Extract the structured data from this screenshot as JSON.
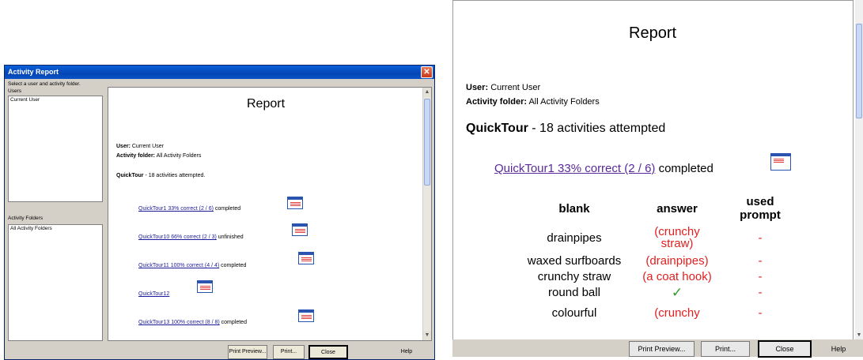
{
  "left_window": {
    "title": "Activity Report",
    "close_glyph": "✕",
    "instructions": "Select a user and activity folder.",
    "users_label": "Users",
    "users": [
      "Current User"
    ],
    "folders_label": "Activity Folders",
    "folders": [
      "All Activity Folders"
    ],
    "report": {
      "title": "Report",
      "user_label": "User:",
      "user_value": "Current User",
      "folder_label": "Activity folder:",
      "folder_value": "All Activity Folders",
      "section_name": "QuickTour",
      "section_summary": " - 18 activities attempted.",
      "entries": [
        {
          "link": "QuickTour1   33% correct (2 / 6)",
          "status": " completed"
        },
        {
          "link": "QuickTour10   66% correct (2 / 3)",
          "status": " unfinished"
        },
        {
          "link": "QuickTour11   100% correct (4 / 4)",
          "status": " completed"
        },
        {
          "link": "QuickTour12   ",
          "status": ""
        },
        {
          "link": "QuickTour13   100% correct (8 / 8)",
          "status": " completed"
        }
      ]
    },
    "buttons": {
      "print_preview": "Print Preview...",
      "print": "Print...",
      "close": "Close",
      "help": "Help"
    }
  },
  "right_window": {
    "report": {
      "title": "Report",
      "user_label": "User:",
      "user_value": "Current User",
      "folder_label": "Activity folder:",
      "folder_value": "All Activity Folders",
      "section_name": "QuickTour",
      "section_summary": " - 18 activities attempted",
      "entry": {
        "link": "QuickTour1   33% correct (2 / 6)",
        "status": " completed"
      },
      "table": {
        "headers": [
          "blank",
          "answer",
          "used prompt"
        ],
        "rows": [
          {
            "blank": "drainpipes",
            "answer": "(crunchy straw)",
            "prompt": "-"
          },
          {
            "blank": "waxed surfboards",
            "answer": "(drainpipes)",
            "prompt": "-"
          },
          {
            "blank": "crunchy straw",
            "answer": "(a coat hook)",
            "prompt": "-"
          },
          {
            "blank": "round ball",
            "answer": "✓",
            "prompt": "-"
          },
          {
            "blank": "colourful",
            "answer": "(crunchy",
            "prompt": "-"
          }
        ]
      }
    },
    "buttons": {
      "print_preview": "Print Preview...",
      "print": "Print...",
      "close": "Close",
      "help": "Help"
    }
  },
  "colors": {
    "titlebar": "#0a53c6",
    "link": "#1a1a9a",
    "wrong_answer": "#e02020",
    "correct_mark": "#2a9a2a"
  }
}
